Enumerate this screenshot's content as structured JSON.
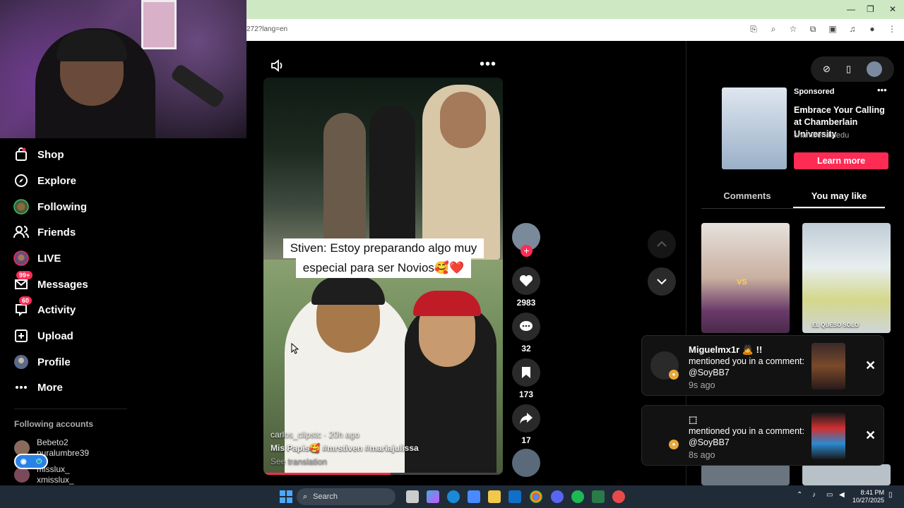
{
  "browser": {
    "url_fragment": "272?lang=en",
    "window_controls": [
      "—",
      "❐",
      "✕"
    ]
  },
  "sidebar": {
    "items": [
      {
        "label": "Shop",
        "icon": "shop-icon"
      },
      {
        "label": "Explore",
        "icon": "compass-icon"
      },
      {
        "label": "Following",
        "icon": "following-avatar-icon"
      },
      {
        "label": "Friends",
        "icon": "friends-icon"
      },
      {
        "label": "LIVE",
        "icon": "live-avatar-icon"
      },
      {
        "label": "Messages",
        "icon": "messages-icon",
        "badge": "99+"
      },
      {
        "label": "Activity",
        "icon": "activity-icon",
        "badge": "60"
      },
      {
        "label": "Upload",
        "icon": "upload-icon"
      },
      {
        "label": "Profile",
        "icon": "profile-avatar-icon"
      },
      {
        "label": "More",
        "icon": "more-icon"
      }
    ],
    "following_title": "Following accounts",
    "accounts": [
      {
        "name": "Bebeto2",
        "handle": "puralumbre39"
      },
      {
        "name": "misslux_",
        "handle": "xmisslux_"
      }
    ]
  },
  "video": {
    "caption_line1": "Stiven: Estoy preparando algo muy",
    "caption_line2": "especial  para ser Novios🥰❤️",
    "author_time": "carlos_clipstc · 20h ago",
    "description": "Mis Papis🥰 #mrstiven  #mariajulissa",
    "translation": "See translation",
    "progress": 0.53
  },
  "actions": {
    "likes": "2983",
    "comments": "32",
    "saves": "173",
    "shares": "17"
  },
  "right_panel": {
    "ad": {
      "sponsored": "Sponsored",
      "title": "Embrace Your Calling at Chamberlain University",
      "handle": "chamberlainedu",
      "cta": "Learn more"
    },
    "tabs": [
      "Comments",
      "You may like"
    ],
    "active_tab": "You may like",
    "thumb2_overlay": "EL QUESO SOLO"
  },
  "notifications": [
    {
      "name": "Miguelmx1r 🙇 !!",
      "text": "mentioned you in a comment: @SoyBB7",
      "time": "9s ago"
    },
    {
      "name": "⬚",
      "text": "mentioned you in a comment: @SoyBB7",
      "time": "8s ago"
    }
  ],
  "taskbar": {
    "search_label": "Search",
    "time": "8:41 PM",
    "date": "10/27/2025"
  },
  "colors": {
    "accent": "#fe2c55",
    "chrome_green": "#cfe8c4",
    "taskbar": "#202b38"
  }
}
